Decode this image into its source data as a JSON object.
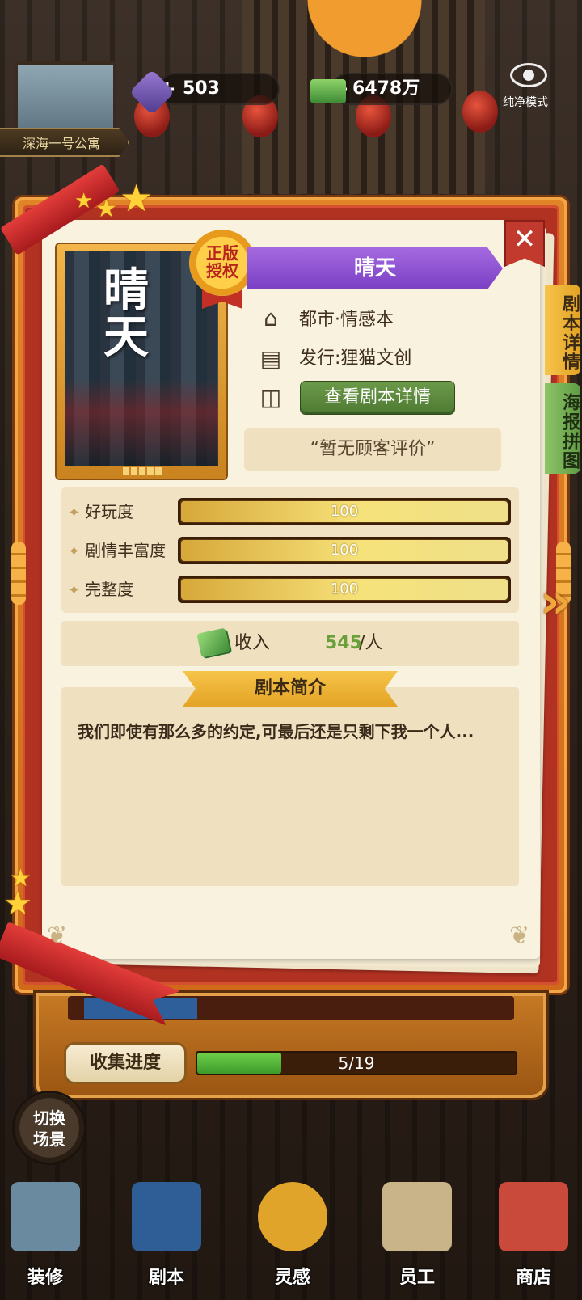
{
  "hud": {
    "gems": "503",
    "cash": "6478万",
    "plus": "+",
    "view_mode_label": "纯净模式",
    "location": "深海一号公寓"
  },
  "script_card": {
    "title": "晴天",
    "poster_title": "晴天",
    "license_badge": "正版\n授权",
    "genre": "都市·情感本",
    "publisher": "发行:狸猫文创",
    "detail_button": "查看剧本详情",
    "review": "“暂无顾客评价”",
    "close": "✕",
    "tabs": [
      "剧本详情",
      "海报拼图"
    ],
    "next_arrow": "»",
    "stats": [
      {
        "label": "好玩度",
        "value": "100",
        "fill": 1.0
      },
      {
        "label": "剧情丰富度",
        "value": "100",
        "fill": 1.0
      },
      {
        "label": "完整度",
        "value": "100",
        "fill": 1.0
      }
    ],
    "stat_sparkle": "✦",
    "income": {
      "label": "收入",
      "value": "545",
      "unit": "/人"
    },
    "synopsis": {
      "header": "剧本简介",
      "text": "我们即使有那么多的约定,可最后还是只剩下我一个人..."
    }
  },
  "collection": {
    "button": "收集进度",
    "progress_text": "5/19",
    "progress": 0.263
  },
  "switch_scene": "切换\n场景",
  "nav": [
    {
      "label": "装修",
      "icon": "decorate-icon",
      "color": "#6a8aa0"
    },
    {
      "label": "剧本",
      "icon": "script-book-icon",
      "color": "#2f5e96"
    },
    {
      "label": "灵感",
      "icon": "idea-bulb-icon",
      "color": "#e0a42a"
    },
    {
      "label": "员工",
      "icon": "staff-card-icon",
      "color": "#c9b48a"
    },
    {
      "label": "商店",
      "icon": "shop-icon",
      "color": "#c94a3a"
    }
  ]
}
